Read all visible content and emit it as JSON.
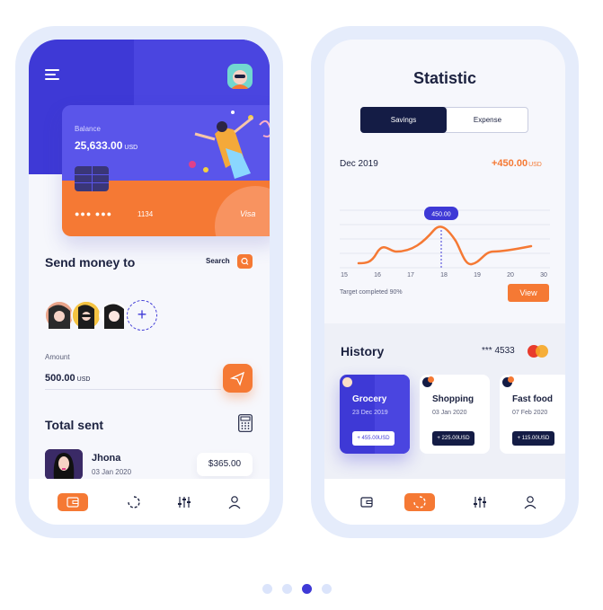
{
  "screen1": {
    "card": {
      "balance_label": "Balance",
      "balance": "25,633.00",
      "currency": "USD",
      "masked_dots": "●●● ●●●",
      "last_digits": "1134",
      "brand": "Visa"
    },
    "send_money": {
      "title": "Send money to",
      "search_label": "Search",
      "add_symbol": "+"
    },
    "amount": {
      "label": "Amount",
      "value": "500.00",
      "currency": "USD"
    },
    "total_sent": {
      "title": "Total sent",
      "user_name": "Jhona",
      "date": "03 Jan 2020",
      "amount": "$365.00"
    }
  },
  "screen2": {
    "title": "Statistic",
    "tabs": [
      "Savings",
      "Expense"
    ],
    "month": "Dec 2019",
    "delta": "+450.00",
    "delta_currency": "USD",
    "target_text": "Target completed 90%",
    "view_label": "View",
    "history": {
      "title": "History",
      "card_last": "*** 4533",
      "items": [
        {
          "title": "Grocery",
          "date": "23 Dec 2019",
          "amount": "+ 455.00USD"
        },
        {
          "title": "Shopping",
          "date": "03 Jan 2020",
          "amount": "+ 225.00USD"
        },
        {
          "title": "Fast food",
          "date": "07 Feb 2020",
          "amount": "+ 115.00USD"
        }
      ]
    }
  },
  "chart_data": {
    "type": "line",
    "x": [
      "15",
      "16",
      "17",
      "18",
      "19",
      "20",
      "30"
    ],
    "tooltip_label": "450.00",
    "title": "",
    "xlabel": "",
    "ylabel": "",
    "grid": true
  },
  "colors": {
    "primary": "#3e39d6",
    "accent": "#f57934",
    "dark": "#141c45"
  },
  "pager": {
    "count": 4,
    "active": 3
  }
}
